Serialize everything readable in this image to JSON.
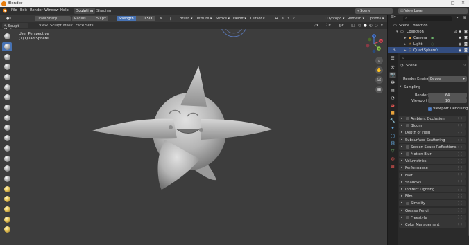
{
  "window": {
    "title": "Blender"
  },
  "menubar": {
    "items": [
      "File",
      "Edit",
      "Render",
      "Window",
      "Help"
    ],
    "workspace_tabs": [
      "Sculpting",
      "Shading"
    ],
    "active_workspace": "Sculpting",
    "scene": "Scene",
    "view_layer": "View Layer"
  },
  "tool_header": {
    "brush": "Draw Sharp",
    "radius_label": "Radius",
    "radius_value": "50 px",
    "strength_label": "Strength",
    "strength_value": "0.500",
    "strength_fraction": 0.5,
    "menus": [
      "Brush",
      "Texture",
      "Stroke",
      "Falloff",
      "Cursor"
    ],
    "dyntopo": "Dyntopo",
    "remesh": "Remesh",
    "options": "Options"
  },
  "mode_header": {
    "mode": "Sculpt Mode",
    "menus": [
      "View",
      "Sculpt",
      "Mask",
      "Face Sets"
    ]
  },
  "viewport": {
    "view_name": "User Perspective",
    "object_name": "(1) Quad Sphere",
    "gizmo_axes": [
      "X",
      "Y",
      "Z"
    ],
    "tool_count": 20,
    "active_tool_index": 1
  },
  "outliner": {
    "rows": [
      {
        "label": "Scene Collection",
        "indent": 0,
        "selected": false
      },
      {
        "label": "Collection",
        "indent": 1,
        "selected": false
      },
      {
        "label": "Camera",
        "indent": 2,
        "selected": false
      },
      {
        "label": "Light",
        "indent": 2,
        "selected": false
      },
      {
        "label": "Quad Sphere",
        "indent": 2,
        "selected": true
      }
    ]
  },
  "properties": {
    "breadcrumb": "Scene",
    "render_engine_label": "Render Engine",
    "render_engine": "Eevee",
    "sampling": {
      "title": "Sampling",
      "render_label": "Render",
      "render_value": "64",
      "viewport_label": "Viewport",
      "viewport_value": "16",
      "denoise_label": "Viewport Denoising",
      "denoise_checked": true
    },
    "panels": [
      {
        "label": "Ambient Occlusion",
        "checkbox": true
      },
      {
        "label": "Bloom",
        "checkbox": true
      },
      {
        "label": "Depth of Field",
        "checkbox": false
      },
      {
        "label": "Subsurface Scattering",
        "checkbox": false
      },
      {
        "label": "Screen Space Reflections",
        "checkbox": true
      },
      {
        "label": "Motion Blur",
        "checkbox": true
      },
      {
        "label": "Volumetrics",
        "checkbox": false
      },
      {
        "label": "Performance",
        "checkbox": false
      },
      {
        "label": "Hair",
        "checkbox": false
      },
      {
        "label": "Shadows",
        "checkbox": false
      },
      {
        "label": "Indirect Lighting",
        "checkbox": false
      },
      {
        "label": "Film",
        "checkbox": false
      },
      {
        "label": "Simplify",
        "checkbox": true
      },
      {
        "label": "Grease Pencil",
        "checkbox": false
      },
      {
        "label": "Freestyle",
        "checkbox": true
      },
      {
        "label": "Color Management",
        "checkbox": false
      }
    ]
  },
  "colors": {
    "accent_blue": "#4772b3",
    "viewport_bg": "#3d3d3d",
    "panel_bg": "#2b2b2b",
    "mesh": "#b9b9b9",
    "blender_orange": "#e87d0d"
  }
}
